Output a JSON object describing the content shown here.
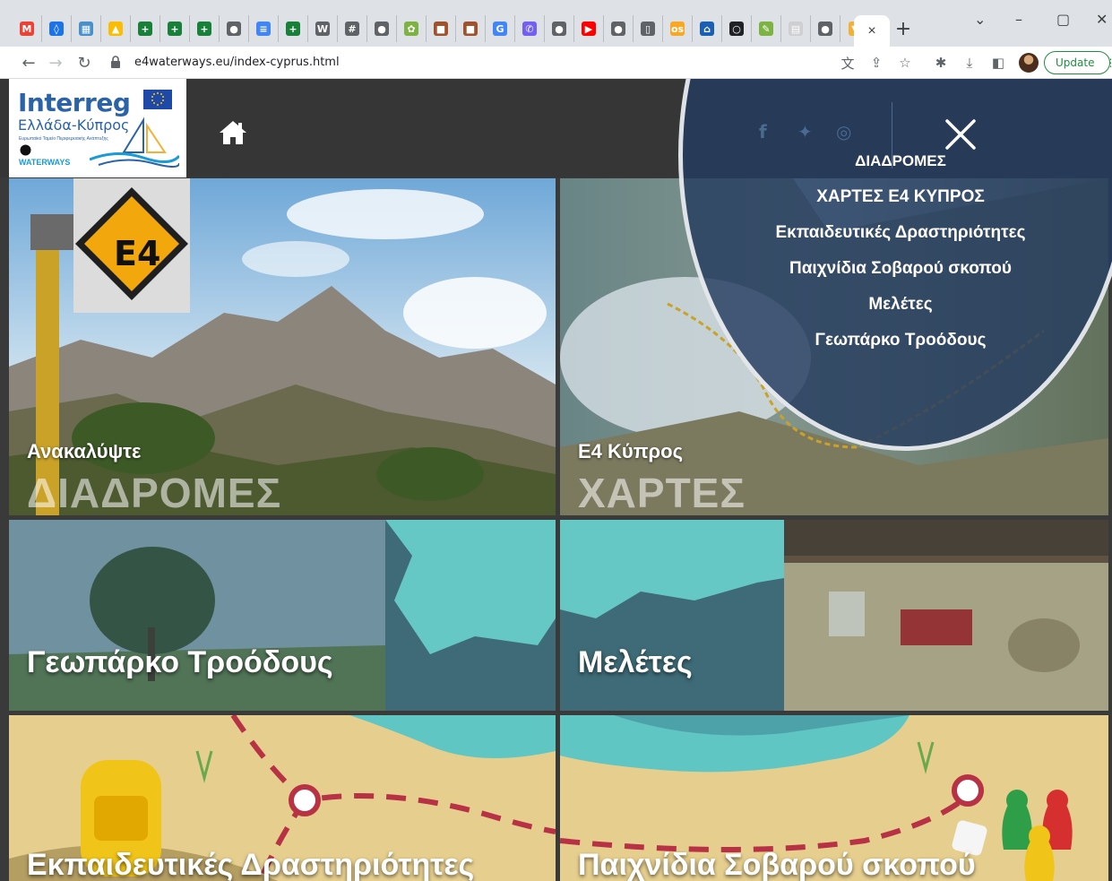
{
  "browser": {
    "pinned_tabs": [
      {
        "icon": "gmail-icon",
        "glyph": "M",
        "color": "#ea4335"
      },
      {
        "icon": "drop-icon",
        "glyph": "◊",
        "color": "#1a73e8"
      },
      {
        "icon": "calculator-icon",
        "glyph": "▦",
        "color": "#4a90c8"
      },
      {
        "icon": "drive-icon",
        "glyph": "▲",
        "color": "#fbbc04"
      },
      {
        "icon": "sheets-icon",
        "glyph": "+",
        "color": "#188038"
      },
      {
        "icon": "sheets-icon",
        "glyph": "+",
        "color": "#188038"
      },
      {
        "icon": "sheets-icon",
        "glyph": "+",
        "color": "#188038"
      },
      {
        "icon": "globe-icon",
        "glyph": "●",
        "color": "#5f6368"
      },
      {
        "icon": "docs-icon",
        "glyph": "≡",
        "color": "#4285f4"
      },
      {
        "icon": "sheets-icon",
        "glyph": "+",
        "color": "#188038"
      },
      {
        "icon": "wikipedia-icon",
        "glyph": "W",
        "color": "#5f6368"
      },
      {
        "icon": "grid-icon",
        "glyph": "#",
        "color": "#5f6368"
      },
      {
        "icon": "globe-icon",
        "glyph": "●",
        "color": "#5f6368"
      },
      {
        "icon": "seal-icon",
        "glyph": "✿",
        "color": "#7cb342"
      },
      {
        "icon": "bag-icon",
        "glyph": "■",
        "color": "#a0522d"
      },
      {
        "icon": "bag-icon",
        "glyph": "■",
        "color": "#a0522d"
      },
      {
        "icon": "google-icon",
        "glyph": "G",
        "color": "#4285f4"
      },
      {
        "icon": "viber-icon",
        "glyph": "✆",
        "color": "#7360f2"
      },
      {
        "icon": "globe-icon",
        "glyph": "●",
        "color": "#5f6368"
      },
      {
        "icon": "youtube-icon",
        "glyph": "▶",
        "color": "#ff0000"
      },
      {
        "icon": "globe-icon",
        "glyph": "●",
        "color": "#5f6368"
      },
      {
        "icon": "document-icon",
        "glyph": "▯",
        "color": "#5f6368"
      },
      {
        "icon": "os-icon",
        "glyph": "os",
        "color": "#f9a825"
      },
      {
        "icon": "museum-icon",
        "glyph": "⌂",
        "color": "#1a5fb4"
      },
      {
        "icon": "circle-icon",
        "glyph": "○",
        "color": "#202124"
      },
      {
        "icon": "pin-icon",
        "glyph": "✎",
        "color": "#7cb342"
      },
      {
        "icon": "map-icon",
        "glyph": "▤",
        "color": "#cfcfcf"
      },
      {
        "icon": "globe-icon",
        "glyph": "●",
        "color": "#5f6368"
      },
      {
        "icon": "shield-icon",
        "glyph": "▼",
        "color": "#f2b134"
      }
    ],
    "active_tab_close": "×",
    "new_tab": "+",
    "url": "e4waterways.eu/index-cyprus.html",
    "update_label": "Update"
  },
  "site": {
    "logo_title": "Interreg",
    "logo_subtitle": "Ελλάδα-Κύπρος",
    "logo_tagline": "Ευρωπαϊκό Ταμείο Περιφερειακής Ανάπτυξης",
    "logo_project": "WATERWAYS",
    "colors": {
      "header": "#363636",
      "menu": "#243c5f",
      "accent": "#2a63a8"
    }
  },
  "menu": {
    "social": [
      "facebook-icon",
      "twitter-icon",
      "instagram-icon"
    ],
    "items": [
      "ΔΙΑΔΡΟΜΕΣ",
      "ΧΑΡΤΕΣ Ε4 ΚΥΠΡΟΣ",
      "Εκπαιδευτικές Δραστηριότητες",
      "Παιχνίδια Σοβαρού σκοπού",
      "Μελέτες",
      "Γεωπάρκο Τροόδους"
    ]
  },
  "tiles": {
    "routes": {
      "small": "Ανακαλύψτε",
      "big": "ΔΙΑΔΡΟΜΕΣ",
      "sign": "E4"
    },
    "maps": {
      "small": "E4 Κύπρος",
      "big": "ΧΑΡΤΕΣ"
    },
    "geopark": {
      "label": "Γεωπάρκο Τροόδους"
    },
    "studies": {
      "label": "Μελέτες"
    },
    "education": {
      "label": "Εκπαιδευτικές Δραστηριότητες"
    },
    "games": {
      "label": "Παιχνίδια Σοβαρού σκοπού"
    }
  }
}
